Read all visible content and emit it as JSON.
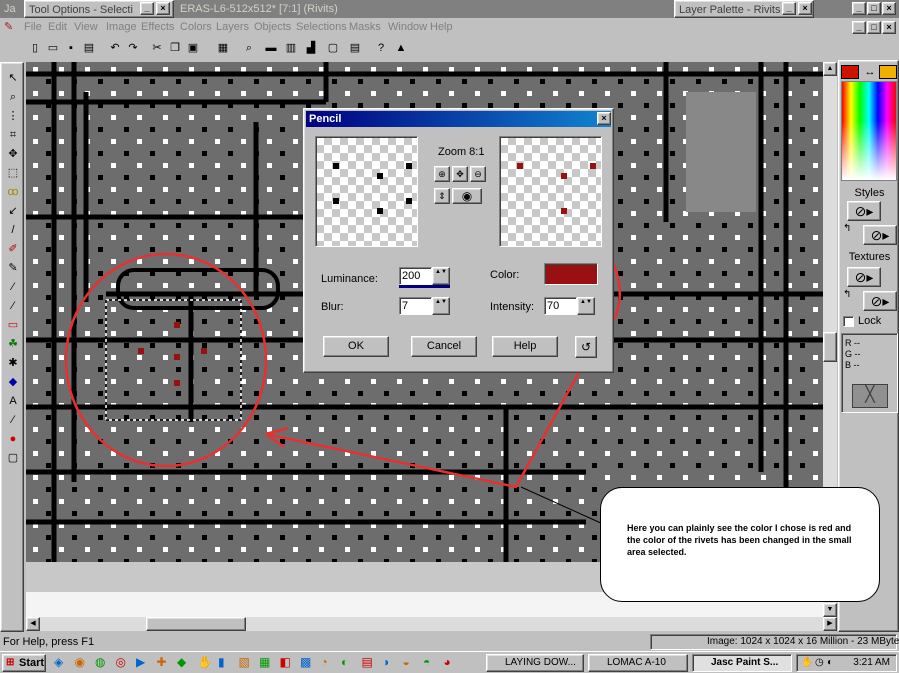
{
  "titlebar": {
    "app_fragment": "Ja",
    "tool_options": "Tool Options - Selecti",
    "document_title": "ERAS-L6-512x512* [7:1] (Rivits)",
    "layer_palette": "Layer Palette - Rivits"
  },
  "menu": [
    "File",
    "Edit",
    "View",
    "Image",
    "Effects",
    "Colors",
    "Layers",
    "Objects",
    "Selections",
    "Masks",
    "Window",
    "Help"
  ],
  "toolbar_icons": [
    "new-icon",
    "open-icon",
    "save-icon",
    "print-icon",
    "undo-icon",
    "redo-icon",
    "cut-icon",
    "copy-icon",
    "paste-icon",
    "browse-icon",
    "zoom-icon",
    "toolbar-toggle-icon",
    "color-palette-icon",
    "histogram-icon",
    "overview-icon",
    "layers-icon",
    "help-icon",
    "lock-icon"
  ],
  "tools": [
    "arrow-tool-icon",
    "zoom-tool-icon",
    "deform-tool-icon",
    "crop-tool-icon",
    "mover-tool-icon",
    "selection-tool-icon",
    "freehand-tool-icon",
    "dropper-tool-icon",
    "paintbrush-tool-icon",
    "clone-tool-icon",
    "color-replacer-icon",
    "retouch-tool-icon",
    "scratch-remover-icon",
    "eraser-tool-icon",
    "picture-tube-icon",
    "airbrush-icon",
    "flood-fill-icon",
    "text-tool-icon",
    "draw-tool-icon",
    "preset-shapes-icon",
    "object-selector-icon"
  ],
  "palette": {
    "foreground": "#cc1100",
    "background": "#f0b000",
    "styles_label": "Styles",
    "textures_label": "Textures",
    "lock_label": "Lock",
    "r_label": "R  --",
    "g_label": "G  --",
    "b_label": "B  --"
  },
  "dialog": {
    "title": "Pencil",
    "zoom_label": "Zoom 8:1",
    "luminance_label": "Luminance:",
    "luminance_value": "200",
    "blur_label": "Blur:",
    "blur_value": "7",
    "color_label": "Color:",
    "color_value": "#9a1010",
    "intensity_label": "Intensity:",
    "intensity_value": "70",
    "ok_label": "OK",
    "cancel_label": "Cancel",
    "help_label": "Help"
  },
  "callout": {
    "text": "Here you can plainly see the color I chose is red and the color of the rivets has been changed in the small area selected."
  },
  "status": {
    "help": "For Help, press F1",
    "image_info": "Image:  1024 x 1024 x 16 Million - 23 MBytes"
  },
  "taskbar": {
    "start": "Start",
    "tasks": [
      "LAYING DOW...",
      "LOMAC A-10",
      "Jasc Paint S..."
    ],
    "clock": "3:21 AM"
  },
  "colors": {
    "annotation": "#e83030",
    "rivet": "#ffffff",
    "rivet_red": "#9a1010",
    "canvas": "#6d6d6d"
  }
}
